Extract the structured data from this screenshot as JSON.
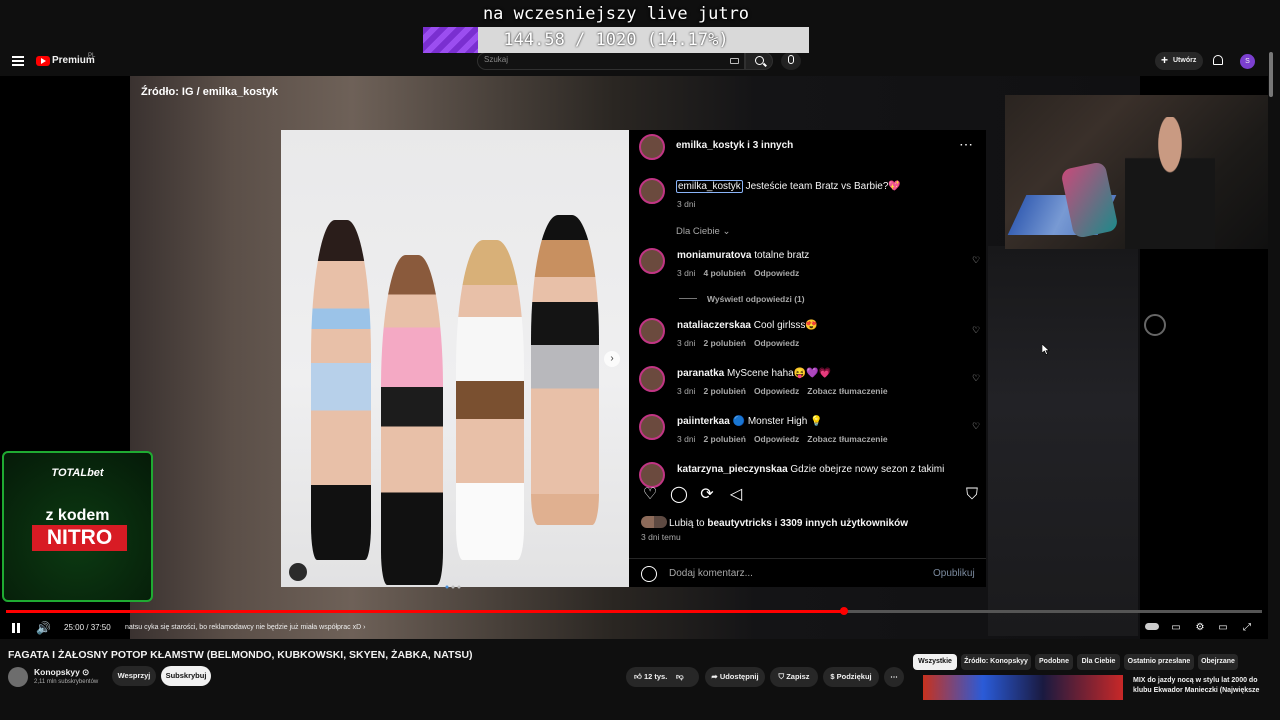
{
  "overlay": {
    "title": "na wczesniejszy live jutro",
    "goal_text": "144.58 / 1020 (14.17%)",
    "goal_progress": 0.1417
  },
  "header": {
    "logo": "Premium",
    "region": "PL",
    "search_placeholder": "Szukaj",
    "create_label": "Utwórz",
    "avatar_letter": "S"
  },
  "video": {
    "source_label": "Źródło: IG / emilka_kostyk",
    "ig": {
      "header_user": "emilka_kostyk i 3 innych",
      "caption_user": "emilka_kostyk",
      "caption_text": " Jesteście team Bratz vs Barbie?💖",
      "caption_time": "3 dni",
      "for_you": "Dla Ciebie ⌄",
      "comments": [
        {
          "user": "moniamuratova",
          "text": " totalne bratz",
          "meta": [
            "3 dni",
            "4 polubień",
            "Odpowiedz"
          ]
        },
        {
          "user": "nataliaczerskaa",
          "text": " Cool girlsss😍",
          "meta": [
            "3 dni",
            "2 polubień",
            "Odpowiedz"
          ]
        },
        {
          "user": "paranatka",
          "text": " MyScene haha😝💜💗",
          "meta": [
            "3 dni",
            "2 polubień",
            "Odpowiedz",
            "Zobacz tłumaczenie"
          ]
        },
        {
          "user": "paiinterkaa",
          "text": " 🔵 Monster High 💡",
          "meta": [
            "3 dni",
            "2 polubień",
            "Odpowiedz",
            "Zobacz tłumaczenie"
          ]
        },
        {
          "user": "katarzyna_pieczynskaa",
          "text": " Gdzie obejrze nowy sezon z takimi",
          "meta": []
        }
      ],
      "view_replies": "Wyświetl odpowiedzi (1)",
      "likes_prefix": "Lubią to ",
      "likes_bold": "beautyvtricks i 3309 innych użytkowników",
      "posted": "3 dni temu",
      "comment_placeholder": "Dodaj komentarz...",
      "post_label": "Opublikuj"
    },
    "ad": {
      "brand": "TOTALbet",
      "line1": "z kodem",
      "code": "NITRO"
    }
  },
  "player": {
    "time": "25:00 / 37:50",
    "chapter": "natsu cyka się starości, bo reklamodawcy nie będzie już miała współprac xD ›",
    "progress": 0.667
  },
  "below": {
    "title": "FAGATA I ŻAŁOSNY POTOP KŁAMSTW (BELMONDO, KUBKOWSKI, SKYEN, ŻABKA, NATSU)",
    "channel": "Konopskyy ⊙",
    "subscribers": "2,11 mln subskrybentów",
    "support": "Wesprzyj",
    "subscribe": "Subskrybuj",
    "likes": "12 tys.",
    "share": "Udostępnij",
    "save": "Zapisz",
    "thanks": "Podziękuj",
    "chips": [
      "Wszystkie",
      "Źródło: Konopskyy",
      "Podobne",
      "Dla Ciebie",
      "Ostatnio przesłane",
      "Obejrzane"
    ],
    "rec_title": "MIX do jazdy nocą w stylu lat 2000 do klubu Ekwador Manieczki (Największe"
  }
}
